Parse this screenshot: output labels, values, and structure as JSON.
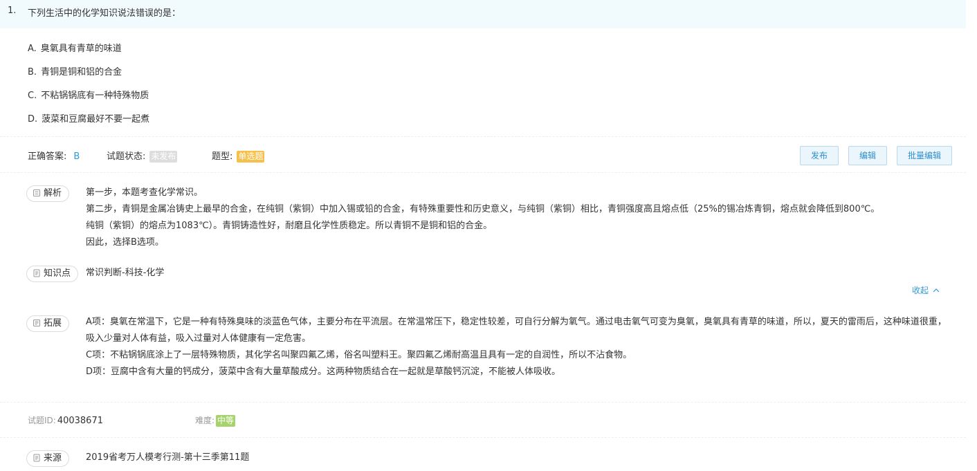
{
  "question": {
    "number": "1.",
    "stem": "下列生活中的化学知识说法错误的是：",
    "options": [
      {
        "letter": "A.",
        "text": "臭氧具有青草的味道"
      },
      {
        "letter": "B.",
        "text": "青铜是铜和铝的合金"
      },
      {
        "letter": "C.",
        "text": "不粘锅锅底有一种特殊物质"
      },
      {
        "letter": "D.",
        "text": "菠菜和豆腐最好不要一起煮"
      }
    ]
  },
  "meta": {
    "answer_label": "正确答案:",
    "answer_value": "B",
    "status_label": "试题状态:",
    "status_value": "未发布",
    "type_label": "题型:",
    "type_value": "单选题"
  },
  "actions": {
    "publish": "发布",
    "edit": "编辑",
    "batch_edit": "批量编辑"
  },
  "analysis": {
    "label": "解析",
    "lines": [
      "第一步，本题考查化学常识。",
      "第二步，青铜是金属冶铸史上最早的合金，在纯铜（紫铜）中加入锡或铅的合金，有特殊重要性和历史意义，与纯铜（紫铜）相比，青铜强度高且熔点低（25%的锡冶炼青铜，熔点就会降低到800℃。",
      "纯铜（紫铜）的熔点为1083℃）。青铜铸造性好，耐磨且化学性质稳定。所以青铜不是铜和铝的合金。",
      "因此，选择B选项。"
    ]
  },
  "knowledge": {
    "label": "知识点",
    "value": "常识判断-科技-化学"
  },
  "collapse": {
    "label": "收起",
    "icon": "chevron-up-icon"
  },
  "extension": {
    "label": "拓展",
    "lines": [
      "A项：臭氧在常温下，它是一种有特殊臭味的淡蓝色气体，主要分布在平流层。在常温常压下，稳定性较差，可自行分解为氧气。通过电击氧气可变为臭氧，臭氧具有青草的味道，所以，夏天的雷雨后，这种味道很重，吸入少量对人体有益，吸入过量对人体健康有一定危害。",
      "C项：不粘锅锅底涂上了一层特殊物质，其化学名叫聚四氟乙烯，俗名叫塑料王。聚四氟乙烯耐高温且具有一定的自润性，所以不沾食物。",
      "D项：豆腐中含有大量的钙成分，菠菜中含有大量草酸成分。这两种物质结合在一起就是草酸钙沉淀，不能被人体吸收。"
    ]
  },
  "footer": {
    "id_label": "试题ID:",
    "id_value": "40038671",
    "difficulty_label": "难度:",
    "difficulty_value": "中等"
  },
  "source": {
    "label": "来源",
    "value": "2019省考万人模考行测-第十三季第11题"
  },
  "colors": {
    "header_bg": "#f1fafd",
    "link": "#2f9bd6",
    "tag_orange": "#f7c04a",
    "tag_green": "#a7d36c",
    "tag_gray": "#dddddd"
  }
}
